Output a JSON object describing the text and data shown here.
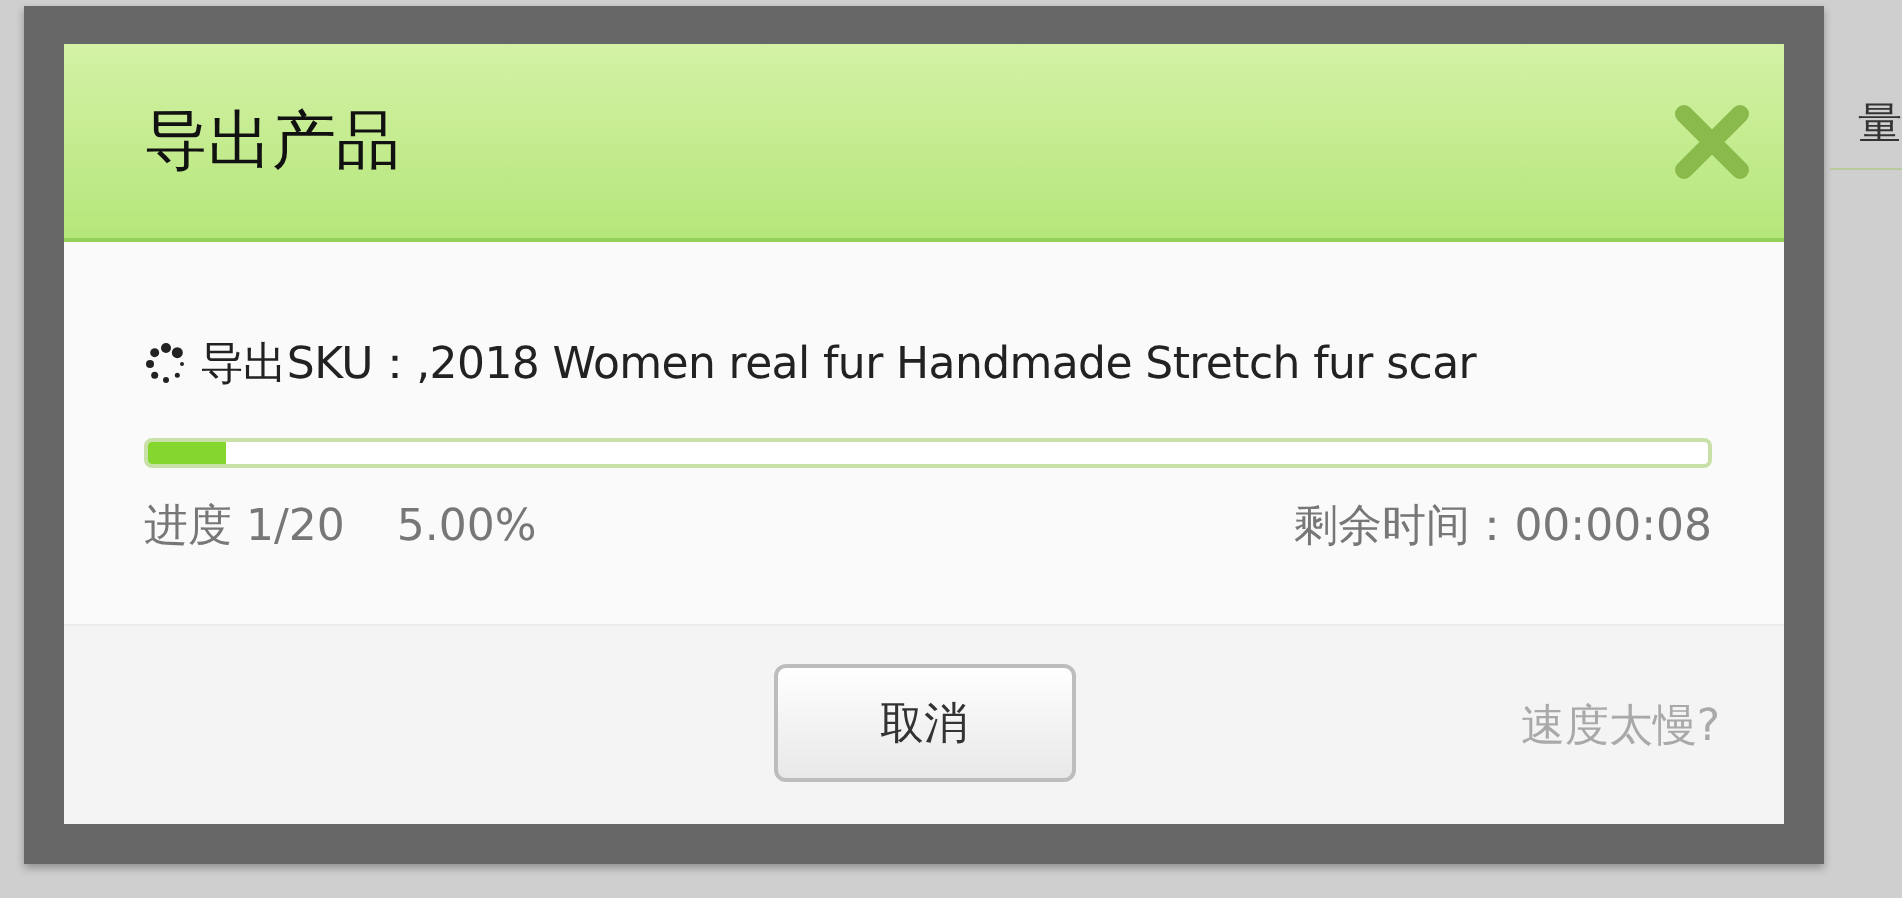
{
  "background_page": {
    "right_texts": [
      "量"
    ]
  },
  "dialog": {
    "title": "导出产品",
    "status_text": "导出SKU：,2018 Women real fur Handmade Stretch fur scar",
    "progress": {
      "level": 0.05
    },
    "progress_count": "进度 1/20",
    "progress_percent": "5.00%",
    "remaining": "剩余时间：00:00:08",
    "cancel_button": "取消",
    "slow_link": "速度太慢?"
  }
}
